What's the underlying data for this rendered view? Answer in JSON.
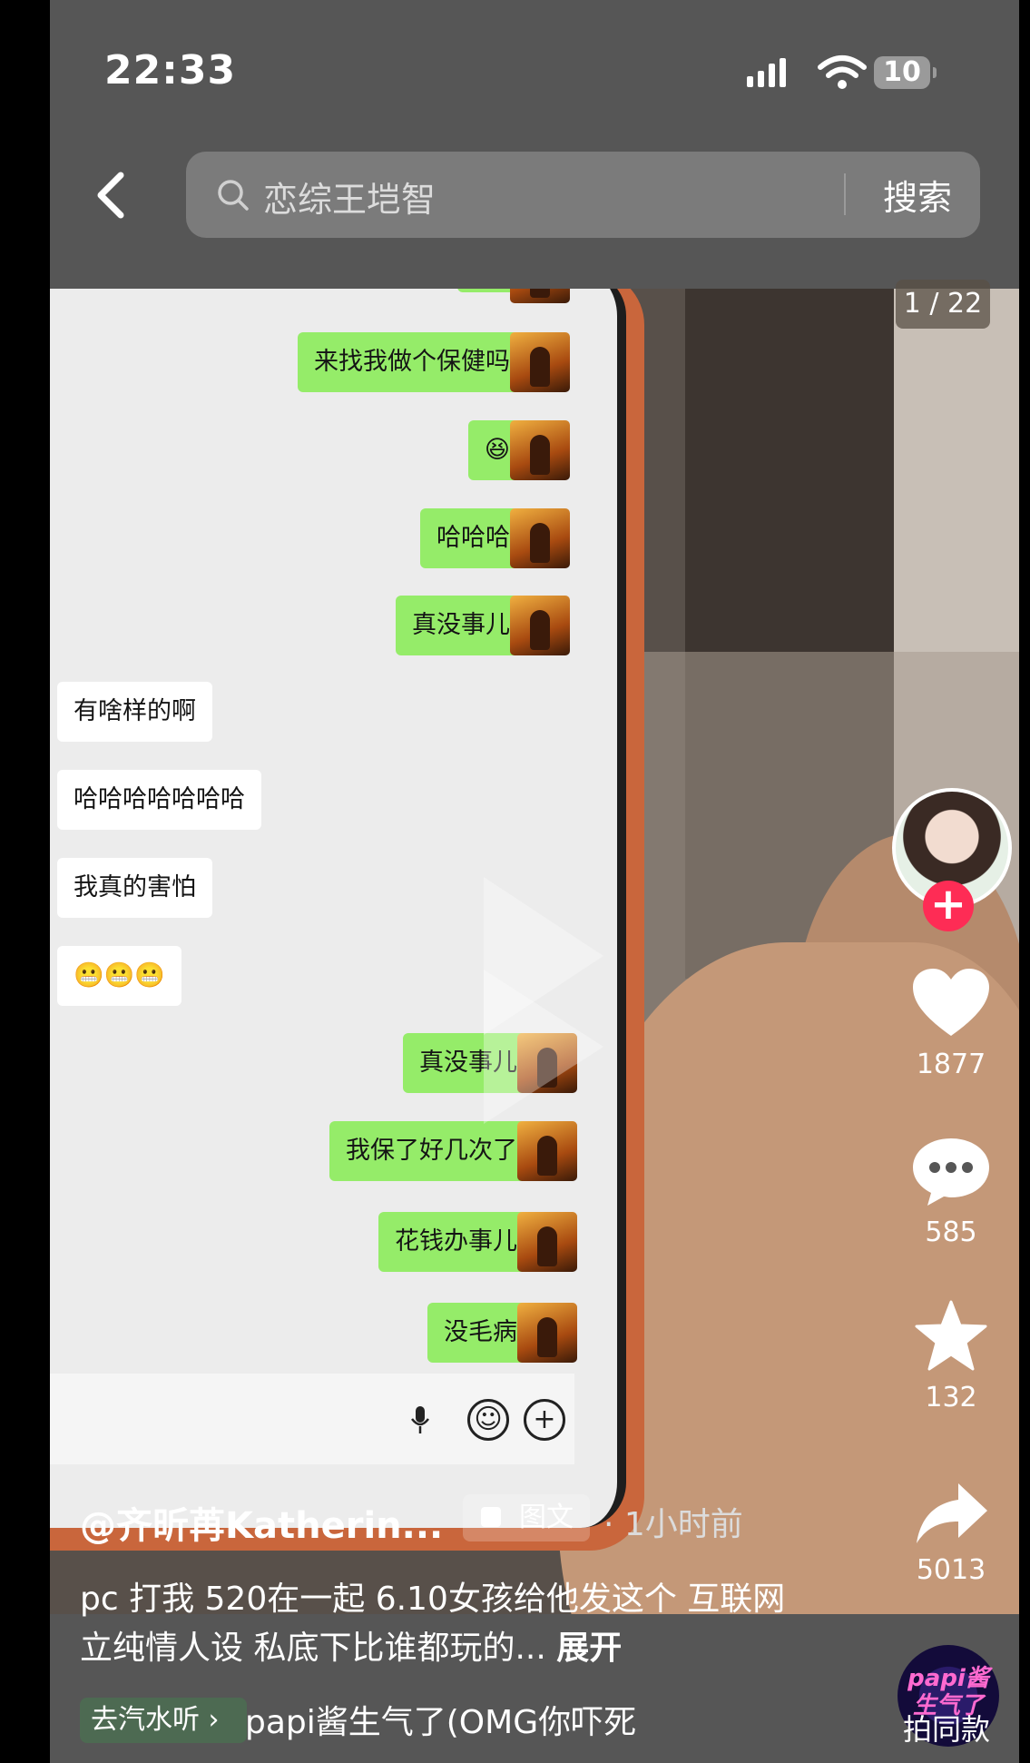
{
  "status_bar": {
    "time": "22:33",
    "battery": "10"
  },
  "search": {
    "query": "恋综王垲智",
    "button_label": "搜索"
  },
  "media": {
    "page_counter": "1 / 22",
    "chat": {
      "right_messages": [
        "来找我做个保健吗",
        "😆",
        "哈哈哈",
        "真没事儿"
      ],
      "left_messages": [
        "有啥样的啊",
        "哈哈哈哈哈哈哈",
        "我真的害怕",
        "😬😬😬"
      ],
      "right_messages_2": [
        "真没事儿",
        "我保了好几次了",
        "花钱办事儿",
        "没毛病"
      ]
    }
  },
  "actions": {
    "likes": "1877",
    "comments": "585",
    "favorites": "132",
    "shares": "5013"
  },
  "post": {
    "author": "@齐昕苒Katherin...",
    "tag_label": "图文",
    "time_ago": "· 1小时前",
    "caption": "pc 打我 520在一起 6.10女孩给他发这个 互联网立纯情人设 私底下比谁都玩的...",
    "expand_label": "展开"
  },
  "music": {
    "link_label": "去汽水听 ›",
    "title": "papi酱生气了(OMG你吓死",
    "disc_text": "papi酱生气了",
    "same_style_label": "拍同款"
  },
  "colors": {
    "follow_plus": "#fe2c55",
    "bubble_green": "#95ec69"
  }
}
